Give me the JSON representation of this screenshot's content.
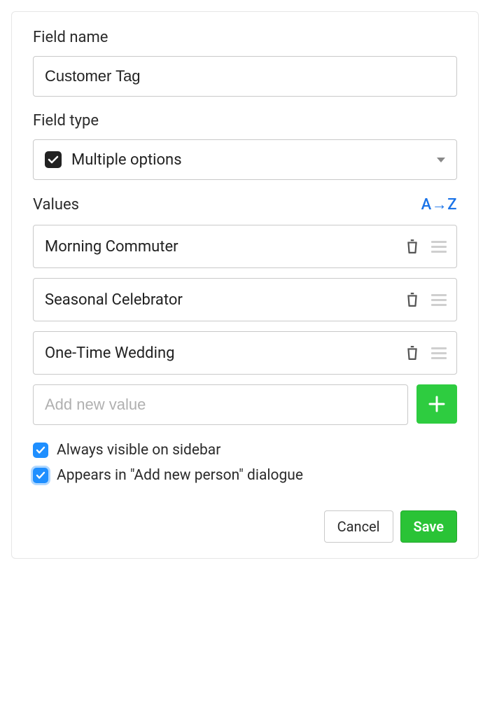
{
  "fieldName": {
    "label": "Field name",
    "value": "Customer Tag"
  },
  "fieldType": {
    "label": "Field type",
    "selected": "Multiple options"
  },
  "values": {
    "label": "Values",
    "sort": "A→Z",
    "items": [
      {
        "text": "Morning Commuter"
      },
      {
        "text": "Seasonal Celebrator"
      },
      {
        "text": "One-Time Wedding"
      }
    ],
    "addPlaceholder": "Add new value"
  },
  "checkboxes": {
    "alwaysVisible": {
      "label": "Always visible on sidebar",
      "checked": true
    },
    "appearsInAdd": {
      "label": "Appears in \"Add new person\" dialogue",
      "checked": true
    }
  },
  "footer": {
    "cancel": "Cancel",
    "save": "Save"
  }
}
